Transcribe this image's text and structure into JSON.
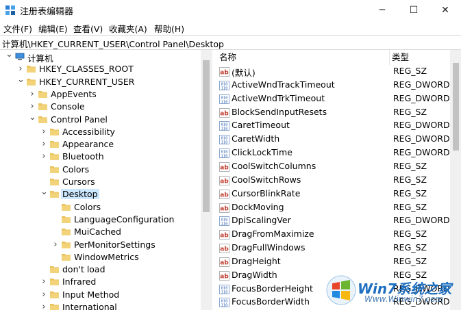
{
  "window": {
    "title": "注册表编辑器",
    "minimize": "─",
    "maximize": "☐",
    "close": "✕"
  },
  "menu": [
    "文件(F)",
    "编辑(E)",
    "查看(V)",
    "收藏夹(A)",
    "帮助(H)"
  ],
  "address": "计算机\\HKEY_CURRENT_USER\\Control Panel\\Desktop",
  "tree": [
    {
      "label": "计算机",
      "depth": 0,
      "expanded": true,
      "icon": "computer-icon"
    },
    {
      "label": "HKEY_CLASSES_ROOT",
      "depth": 1,
      "expanded": false
    },
    {
      "label": "HKEY_CURRENT_USER",
      "depth": 1,
      "expanded": true
    },
    {
      "label": "AppEvents",
      "depth": 2,
      "expanded": false
    },
    {
      "label": "Console",
      "depth": 2,
      "expanded": false
    },
    {
      "label": "Control Panel",
      "depth": 2,
      "expanded": true
    },
    {
      "label": "Accessibility",
      "depth": 3,
      "expanded": false
    },
    {
      "label": "Appearance",
      "depth": 3,
      "expanded": false
    },
    {
      "label": "Bluetooth",
      "depth": 3,
      "expanded": false
    },
    {
      "label": "Colors",
      "depth": 3,
      "leaf": true
    },
    {
      "label": "Cursors",
      "depth": 3,
      "leaf": true
    },
    {
      "label": "Desktop",
      "depth": 3,
      "expanded": true,
      "selected": true
    },
    {
      "label": "Colors",
      "depth": 4,
      "leaf": true
    },
    {
      "label": "LanguageConfiguration",
      "depth": 4,
      "leaf": true
    },
    {
      "label": "MuiCached",
      "depth": 4,
      "leaf": true
    },
    {
      "label": "PerMonitorSettings",
      "depth": 4,
      "expanded": false
    },
    {
      "label": "WindowMetrics",
      "depth": 4,
      "leaf": true
    },
    {
      "label": "don't load",
      "depth": 3,
      "leaf": true
    },
    {
      "label": "Infrared",
      "depth": 3,
      "expanded": false
    },
    {
      "label": "Input Method",
      "depth": 3,
      "expanded": false
    },
    {
      "label": "International",
      "depth": 3,
      "expanded": false
    }
  ],
  "columns": {
    "name": "名称",
    "type": "类型"
  },
  "values": [
    {
      "name": "(默认)",
      "type": "REG_SZ",
      "kind": "string"
    },
    {
      "name": "ActiveWndTrackTimeout",
      "type": "REG_DWORD",
      "kind": "binary"
    },
    {
      "name": "ActiveWndTrkTimeout",
      "type": "REG_DWORD",
      "kind": "binary"
    },
    {
      "name": "BlockSendInputResets",
      "type": "REG_SZ",
      "kind": "string"
    },
    {
      "name": "CaretTimeout",
      "type": "REG_DWORD",
      "kind": "binary"
    },
    {
      "name": "CaretWidth",
      "type": "REG_DWORD",
      "kind": "binary"
    },
    {
      "name": "ClickLockTime",
      "type": "REG_DWORD",
      "kind": "binary"
    },
    {
      "name": "CoolSwitchColumns",
      "type": "REG_SZ",
      "kind": "string"
    },
    {
      "name": "CoolSwitchRows",
      "type": "REG_SZ",
      "kind": "string"
    },
    {
      "name": "CursorBlinkRate",
      "type": "REG_SZ",
      "kind": "string"
    },
    {
      "name": "DockMoving",
      "type": "REG_SZ",
      "kind": "string"
    },
    {
      "name": "DpiScalingVer",
      "type": "REG_DWORD",
      "kind": "binary"
    },
    {
      "name": "DragFromMaximize",
      "type": "REG_SZ",
      "kind": "string"
    },
    {
      "name": "DragFullWindows",
      "type": "REG_SZ",
      "kind": "string"
    },
    {
      "name": "DragHeight",
      "type": "REG_SZ",
      "kind": "string"
    },
    {
      "name": "DragWidth",
      "type": "REG_SZ",
      "kind": "string"
    },
    {
      "name": "FocusBorderHeight",
      "type": "REG_DWORD",
      "kind": "binary"
    },
    {
      "name": "FocusBorderWidth",
      "type": "REG_DWORD",
      "kind": "binary"
    }
  ],
  "watermark": {
    "brand": "Win7系统之家",
    "url": "Www.Winwin7.com"
  },
  "colors": {
    "selection": "#cce8ff",
    "folder": "#e8c15a",
    "string_icon": "#c0392b",
    "binary_icon": "#2a5caa"
  }
}
